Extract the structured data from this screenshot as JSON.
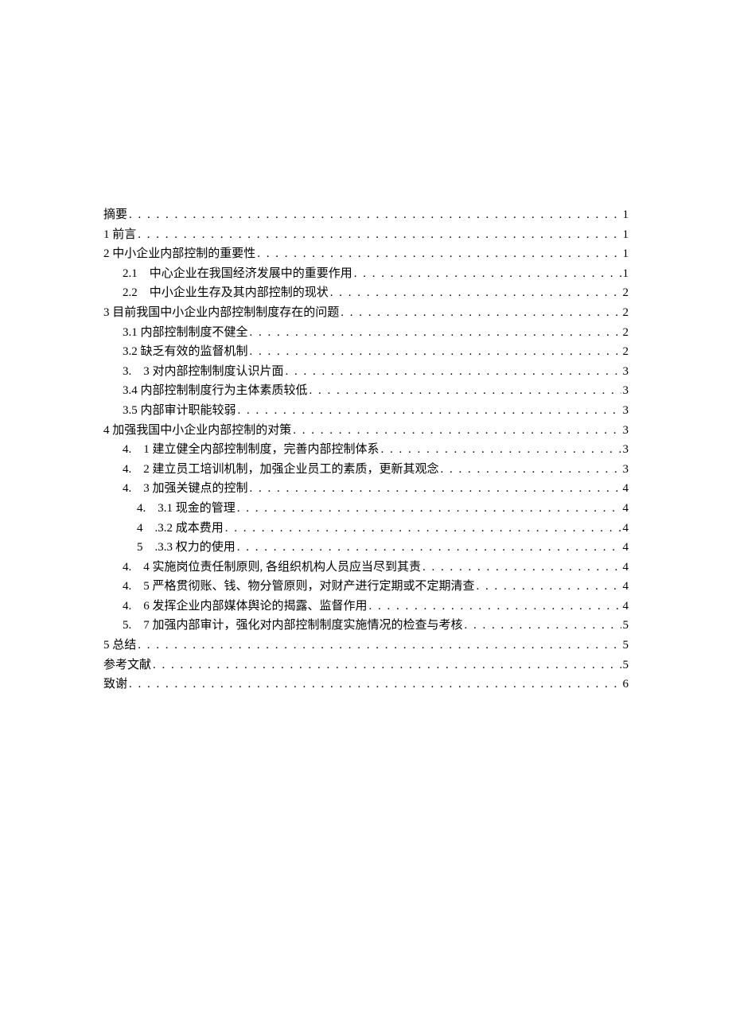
{
  "toc": {
    "entries": [
      {
        "level": 0,
        "label": "摘要",
        "page": "1"
      },
      {
        "level": 0,
        "label": "1 前言",
        "page": "1"
      },
      {
        "level": 0,
        "label": "2 中小企业内部控制的重要性",
        "page": "1"
      },
      {
        "level": 1,
        "label": "2.1　中心企业在我国经济发展中的重要作用",
        "page": "1"
      },
      {
        "level": 1,
        "label": "2.2　中小企业生存及其内部控制的现状",
        "page": "2"
      },
      {
        "level": 0,
        "label": "3 目前我国中小企业内部控制制度存在的问题",
        "page": "2"
      },
      {
        "level": 1,
        "label": "3.1 内部控制制度不健全",
        "page": "2"
      },
      {
        "level": 1,
        "label": "3.2 缺乏有效的监督机制",
        "page": "2"
      },
      {
        "level": 1,
        "label": "3.　3 对内部控制制度认识片面",
        "page": "3"
      },
      {
        "level": 1,
        "label": "3.4 内部控制制度行为主体素质较低",
        "page": "3"
      },
      {
        "level": 1,
        "label": "3.5 内部审计职能较弱",
        "page": "3"
      },
      {
        "level": 0,
        "label": "4 加强我国中小企业内部控制的对策",
        "page": "3"
      },
      {
        "level": 1,
        "label": "4.　1 建立健全内部控制制度，完善内部控制体系",
        "page": "3"
      },
      {
        "level": 1,
        "label": "4.　2 建立员工培训机制，加强企业员工的素质，更新其观念",
        "page": "3"
      },
      {
        "level": 1,
        "label": "4.　3 加强关键点的控制",
        "page": "4"
      },
      {
        "level": 2,
        "label": "4.　3.1 现金的管理",
        "page": "4"
      },
      {
        "level": 2,
        "label": "4　.3.2 成本费用",
        "page": "4"
      },
      {
        "level": 2,
        "label": "5　.3.3 权力的使用",
        "page": "4"
      },
      {
        "level": 1,
        "label": "4.　4 实施岗位责任制原则, 各组织机构人员应当尽到其责",
        "page": "4"
      },
      {
        "level": 1,
        "label": "4.　5 严格贯彻账、钱、物分管原则，对财产进行定期或不定期清查",
        "page": "4"
      },
      {
        "level": 1,
        "label": "4.　6 发挥企业内部媒体舆论的揭露、监督作用",
        "page": "4"
      },
      {
        "level": 1,
        "label": "5.　7 加强内部审计，强化对内部控制制度实施情况的检查与考核",
        "page": "5"
      },
      {
        "level": 0,
        "label": "5 总结",
        "page": "5"
      },
      {
        "level": 0,
        "label": "参考文献",
        "page": "5"
      },
      {
        "level": 0,
        "label": "致谢",
        "page": "6"
      }
    ]
  }
}
